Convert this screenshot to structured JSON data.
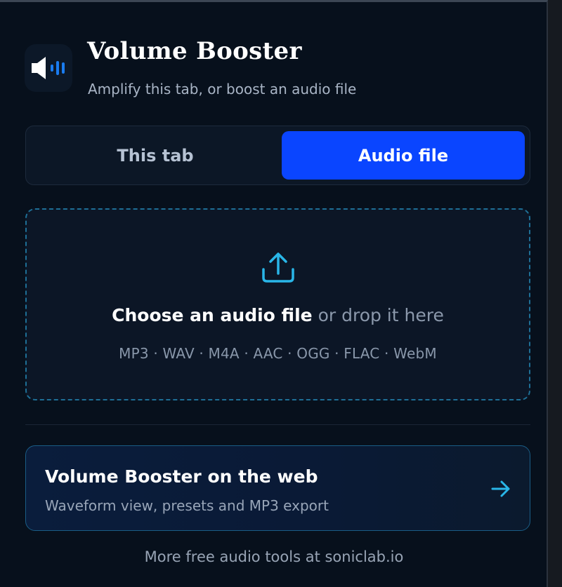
{
  "header": {
    "title": "Volume Booster",
    "subtitle": "Amplify this tab, or boost an audio file",
    "icon": "speaker-volume-icon"
  },
  "tabs": [
    {
      "label": "This tab",
      "active": false
    },
    {
      "label": "Audio file",
      "active": true
    }
  ],
  "dropzone": {
    "icon": "upload-icon",
    "primary_text": "Choose an audio file",
    "secondary_text": " or drop it here",
    "formats": "MP3 · WAV · M4A · AAC · OGG · FLAC · WebM"
  },
  "web_card": {
    "title": "Volume Booster on the web",
    "subtitle": "Waveform view, presets and MP3 export",
    "icon": "arrow-right-icon"
  },
  "footer": {
    "link_text": "More free audio tools at soniclab.io"
  },
  "colors": {
    "accent": "#0a45ff",
    "background": "#07101c",
    "cyan": "#29b6e8"
  }
}
